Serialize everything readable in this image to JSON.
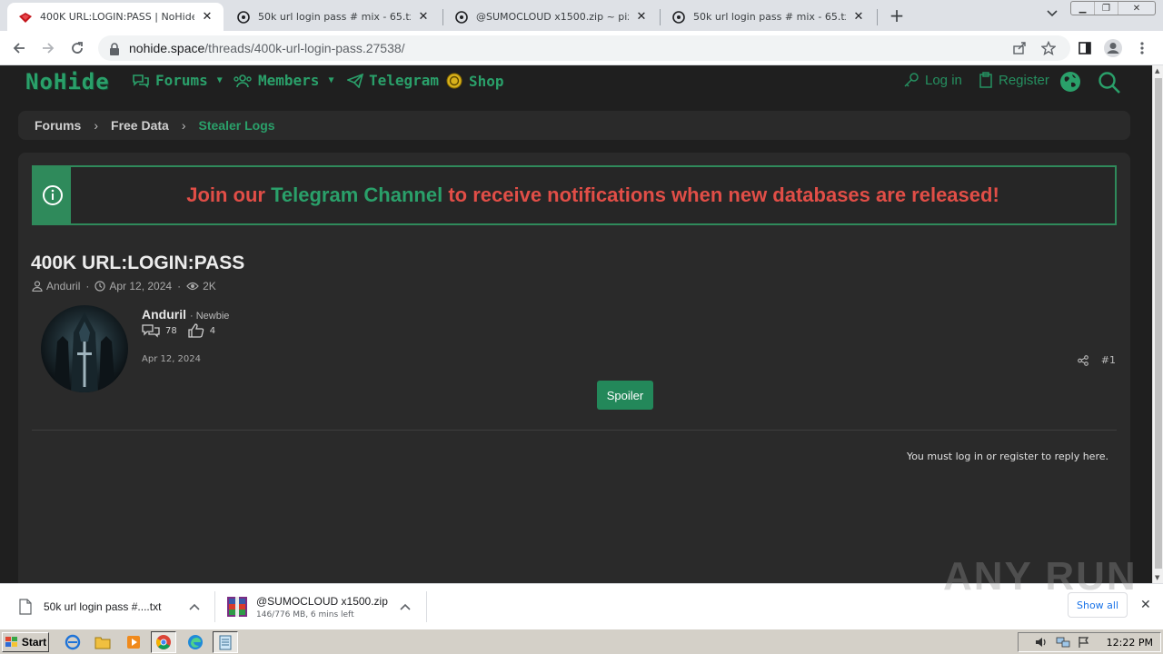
{
  "browser": {
    "tabs": [
      {
        "title": "400K URL:LOGIN:PASS | NoHide",
        "active": true,
        "favicon": "nohide-icon"
      },
      {
        "title": "50k url login pass # mix - 65.txt ~ pi",
        "active": false,
        "favicon": "pixeldrain-icon"
      },
      {
        "title": "@SUMOCLOUD x1500.zip ~ pixeldra",
        "active": false,
        "favicon": "pixeldrain-icon"
      },
      {
        "title": "50k url login pass # mix - 65.txt ~ pi",
        "active": false,
        "favicon": "pixeldrain-icon"
      }
    ],
    "url_host": "nohide.space",
    "url_path": "/threads/400k-url-login-pass.27538/"
  },
  "site": {
    "logo": "NoHide",
    "nav": {
      "forums": "Forums",
      "members": "Members",
      "telegram": "Telegram",
      "shop": "Shop",
      "login": "Log in",
      "register": "Register"
    },
    "accent": "#2aa06a",
    "alert": "#e14e47"
  },
  "breadcrumb": [
    "Forums",
    "Free Data",
    "Stealer Logs"
  ],
  "notice": {
    "before": "Join our ",
    "highlight": "Telegram Channel",
    "after": " to receive notifications when new databases are released!"
  },
  "thread": {
    "title": "400K URL:LOGIN:PASS",
    "author": "Anduril",
    "date": "Apr 12, 2024",
    "views": "2K"
  },
  "post": {
    "author": "Anduril",
    "rank": "· Newbie",
    "messages": "78",
    "reactions": "4",
    "date": "Apr 12, 2024",
    "number": "#1",
    "spoiler_label": "Spoiler",
    "reply_note": "You must log in or register to reply here."
  },
  "downloads": {
    "items": [
      {
        "name": "50k url login pass #....txt",
        "sub": ""
      },
      {
        "name": "@SUMOCLOUD x1500.zip",
        "sub": "146/776 MB, 6 mins left"
      }
    ],
    "show_all": "Show all"
  },
  "watermark": "ANY RUN",
  "taskbar": {
    "start": "Start",
    "clock": "12:22 PM"
  }
}
